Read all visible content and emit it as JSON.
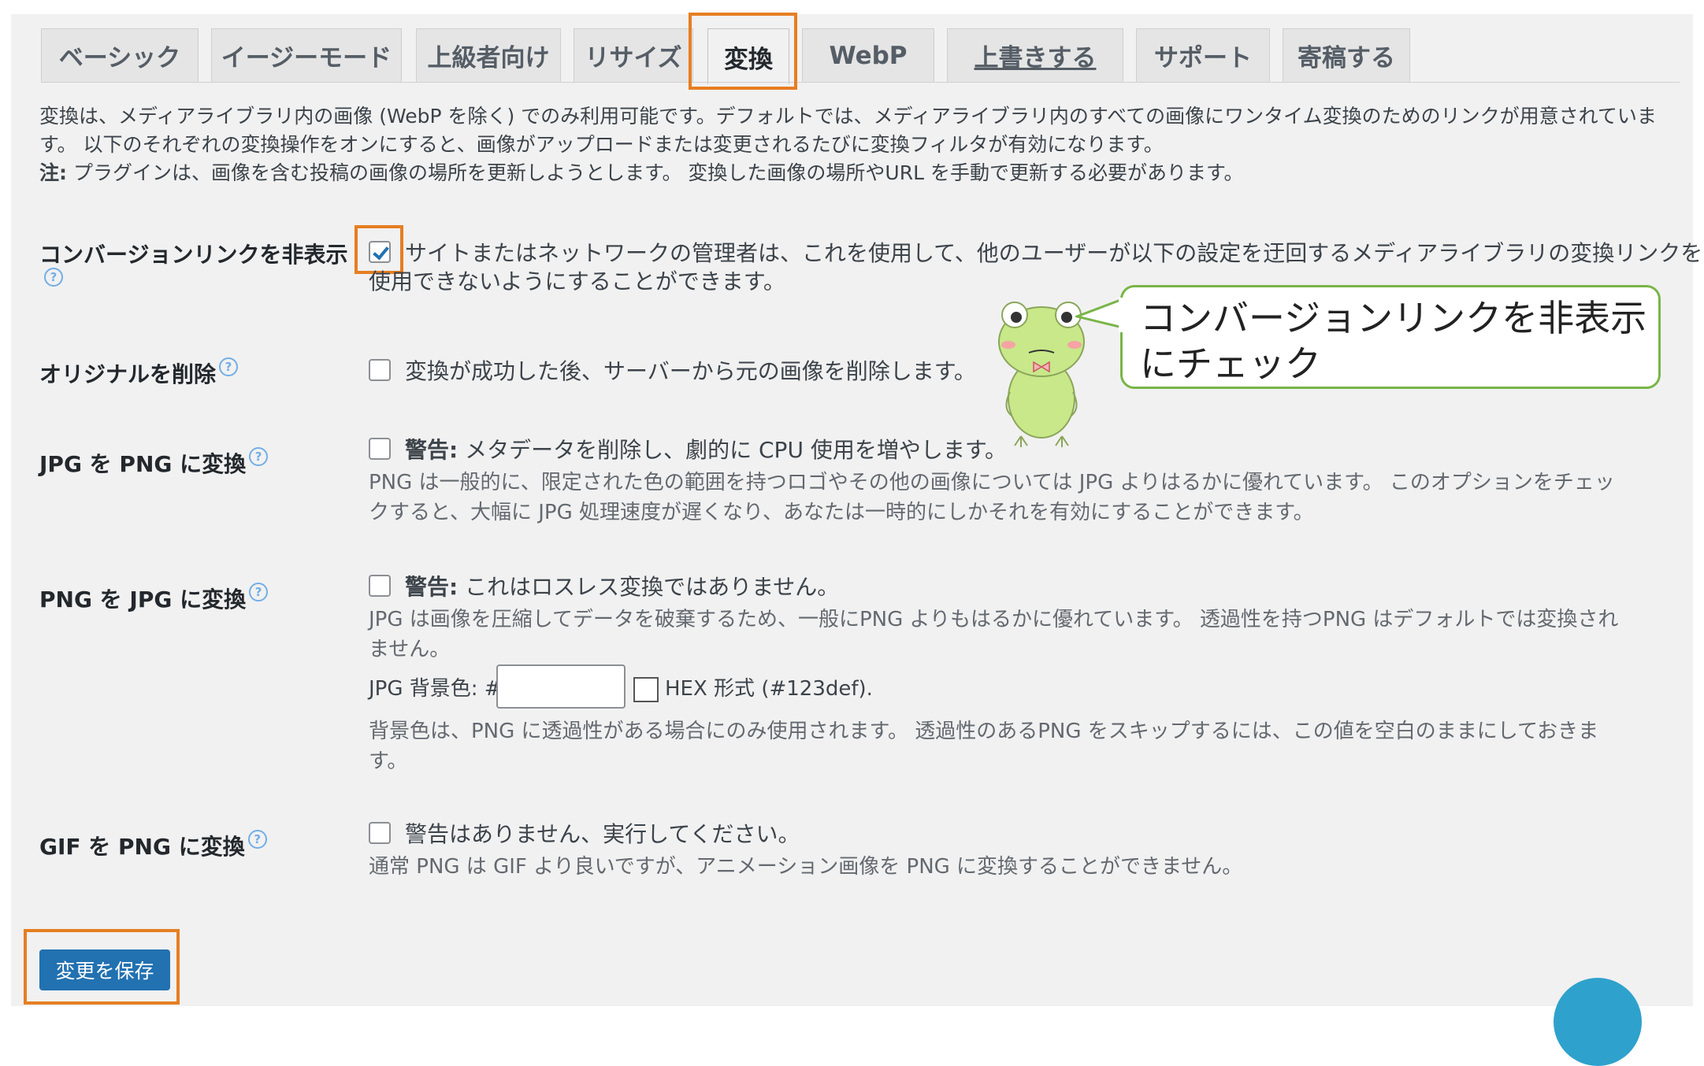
{
  "tabs": [
    {
      "label": "ベーシック",
      "active": false
    },
    {
      "label": "イージーモード",
      "active": false
    },
    {
      "label": "上級者向け",
      "active": false
    },
    {
      "label": "リサイズ",
      "active": false
    },
    {
      "label": "変換",
      "active": true
    },
    {
      "label": "WebP",
      "active": false
    },
    {
      "label": "上書きする",
      "active": false
    },
    {
      "label": "サポート",
      "active": false
    },
    {
      "label": "寄稿する",
      "active": false
    }
  ],
  "intro": {
    "line1": "変換は、メディアライブラリ内の画像 (WebP を除く) でのみ利用可能です。デフォルトでは、メディアライブラリ内のすべての画像にワンタイム変換のためのリンクが用意されていま",
    "line2": "す。 以下のそれぞれの変換操作をオンにすると、画像がアップロードまたは変更されるたびに変換フィルタが有効になります。",
    "note_label": "注:",
    "note_text": " プラグインは、画像を含む投稿の画像の場所を更新しようとします。 変換した画像の場所やURL を手動で更新する必要があります。"
  },
  "settings": {
    "hide_link": {
      "label": "コンバージョンリンクを非表示",
      "checked": true,
      "text1": "サイトまたはネットワークの管理者は、これを使用して、他のユーザーが以下の設定を迂回するメディアライブラリの変換リンクを",
      "text2": "使用できないようにすることができます。"
    },
    "delete_original": {
      "label": "オリジナルを削除",
      "checked": false,
      "text": "変換が成功した後、サーバーから元の画像を削除します。"
    },
    "jpg_to_png": {
      "label": "JPG を PNG に変換",
      "checked": false,
      "warning_label": "警告:",
      "warning_text": " メタデータを削除し、劇的に CPU 使用を増やします。",
      "desc1": "PNG は一般的に、限定された色の範囲を持つロゴやその他の画像については JPG よりはるかに優れています。 このオプションをチェッ",
      "desc2": "クすると、大幅に JPG 処理速度が遅くなり、あなたは一時的にしかそれを有効にすることができます。"
    },
    "png_to_jpg": {
      "label": "PNG を JPG に変換",
      "checked": false,
      "warning_label": "警告:",
      "warning_text": " これはロスレス変換ではありません。",
      "desc1": "JPG は画像を圧縮してデータを破棄するため、一般にPNG よりもはるかに優れています。 透過性を持つPNG はデフォルトでは変換され",
      "desc2": "ません。",
      "bg_label": "JPG 背景色: #",
      "bg_value": "",
      "hex_hint": "HEX 形式 (#123def).",
      "bg_desc1": "背景色は、PNG に透過性がある場合にのみ使用されます。 透過性のあるPNG をスキップするには、この値を空白のままにしておきま",
      "bg_desc2": "す。"
    },
    "gif_to_png": {
      "label": "GIF を PNG に変換",
      "checked": false,
      "text": "警告はありません、実行してください。",
      "desc": "通常 PNG は GIF より良いですが、アニメーション画像を PNG に変換することができません。"
    }
  },
  "save_button": "変更を保存",
  "callout": {
    "line1": "コンバージョンリンクを非表示",
    "line2": "にチェック"
  },
  "colors": {
    "accent": "#2271b1",
    "highlight": "#e67e22",
    "callout_border": "#79b547",
    "frog": "#c8e88a"
  },
  "icons": {
    "help": "question-circle-icon",
    "mascot": "frog-mascot-icon"
  }
}
